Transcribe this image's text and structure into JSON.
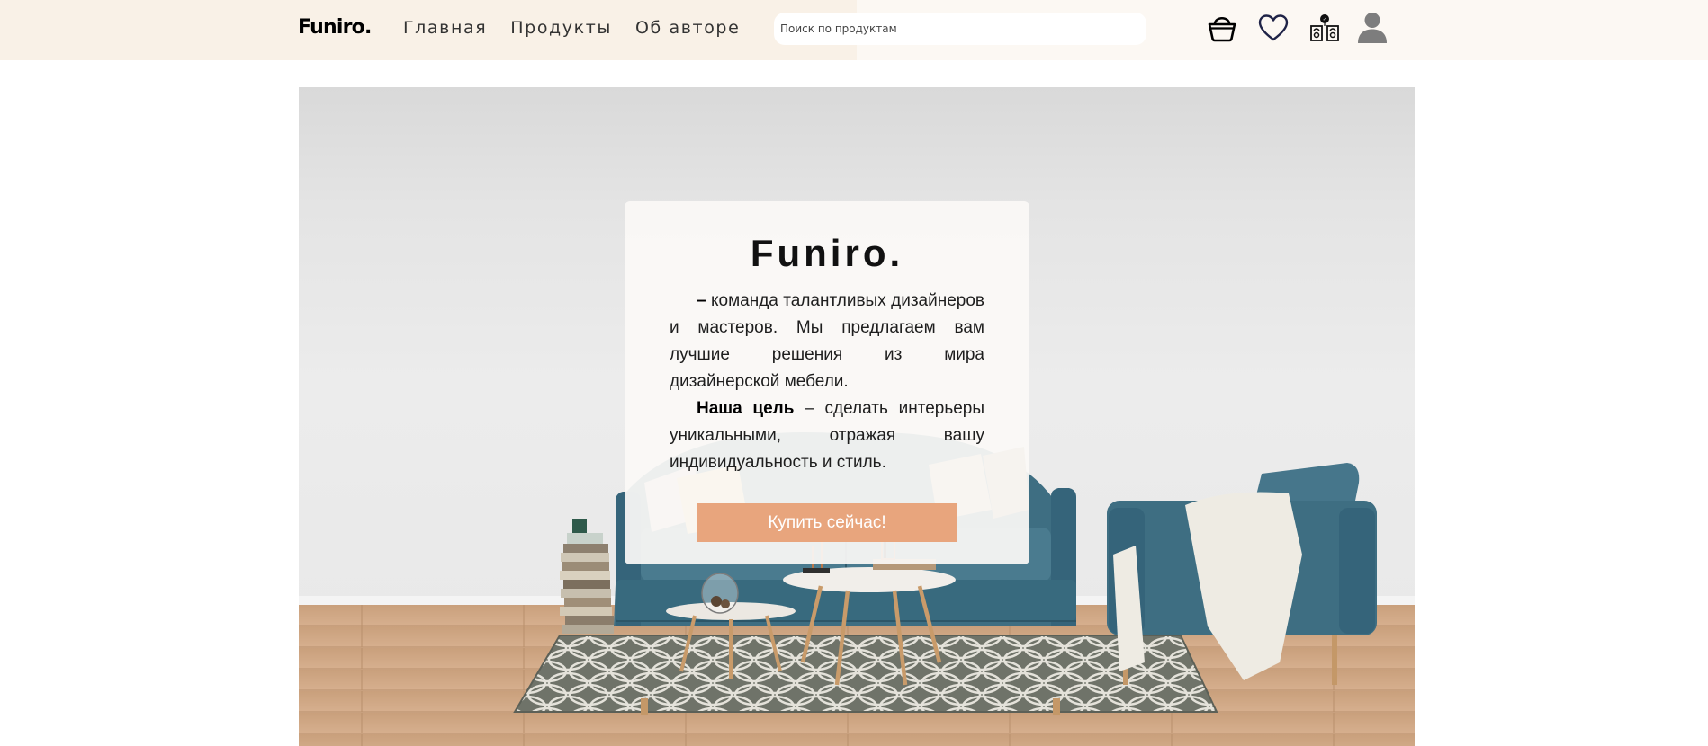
{
  "header": {
    "logo": "Funiro.",
    "nav": [
      "Главная",
      "Продукты",
      "Об авторе"
    ],
    "search_placeholder": "Поиск по продуктам",
    "icons": [
      "basket-icon",
      "heart-icon",
      "orders-icon",
      "user-icon"
    ]
  },
  "hero": {
    "title": "Funiro.",
    "dash": "–",
    "paragraph1": "команда талантливых дизайнеров и мастеров. Мы предлагаем вам лучшие решения из мира дизайнерской мебели.",
    "goal_label": "Наша цель",
    "paragraph2": "– сделать интерьеры уникальными, отражая вашу индивидуальность и стиль.",
    "button": "Купить сейчас!"
  },
  "colors": {
    "header_bg": "#f9f1e7",
    "accent": "#e8a57d",
    "sofa": "#3e6e82"
  }
}
